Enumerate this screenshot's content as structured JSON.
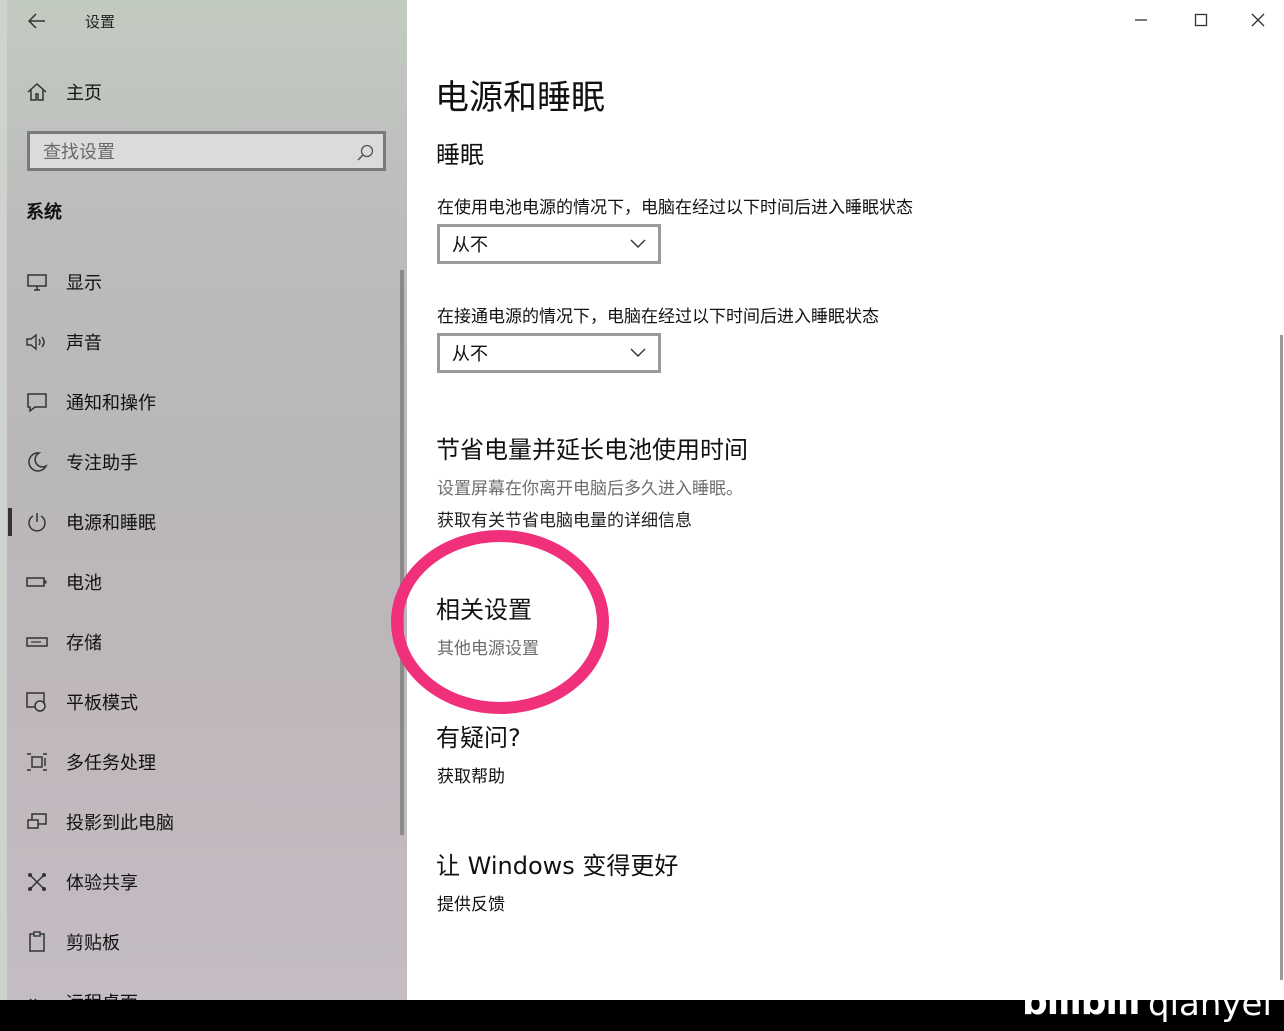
{
  "window": {
    "title": "设置",
    "controls": {
      "minimize": "—",
      "maximize": "☐",
      "close": "✕"
    }
  },
  "sidebar": {
    "home_label": "主页",
    "search_placeholder": "查找设置",
    "section_title": "系统",
    "items": [
      {
        "label": "显示",
        "icon": "display-icon"
      },
      {
        "label": "声音",
        "icon": "speaker-icon"
      },
      {
        "label": "通知和操作",
        "icon": "notification-icon"
      },
      {
        "label": "专注助手",
        "icon": "moon-icon"
      },
      {
        "label": "电源和睡眠",
        "icon": "power-icon",
        "selected": true
      },
      {
        "label": "电池",
        "icon": "battery-icon"
      },
      {
        "label": "存储",
        "icon": "storage-icon"
      },
      {
        "label": "平板模式",
        "icon": "tablet-mode-icon"
      },
      {
        "label": "多任务处理",
        "icon": "multitask-icon"
      },
      {
        "label": "投影到此电脑",
        "icon": "project-icon"
      },
      {
        "label": "体验共享",
        "icon": "share-icon"
      },
      {
        "label": "剪贴板",
        "icon": "clipboard-icon"
      },
      {
        "label": "远程桌面",
        "icon": "remote-desktop-icon"
      }
    ]
  },
  "main": {
    "title": "电源和睡眠",
    "sleep": {
      "heading": "睡眠",
      "battery_label": "在使用电池电源的情况下，电脑在经过以下时间后进入睡眠状态",
      "battery_value": "从不",
      "plugged_label": "在接通电源的情况下，电脑在经过以下时间后进入睡眠状态",
      "plugged_value": "从不"
    },
    "save_power": {
      "heading": "节省电量并延长电池使用时间",
      "desc": "设置屏幕在你离开电脑后多久进入睡眠。",
      "link": "获取有关节省电脑电量的详细信息"
    },
    "related": {
      "heading": "相关设置",
      "link": "其他电源设置"
    },
    "questions": {
      "heading": "有疑问?",
      "link": "获取帮助"
    },
    "improve": {
      "heading": "让 Windows 变得更好",
      "link": "提供反馈"
    }
  },
  "watermark": {
    "text": "qianyei"
  },
  "colors": {
    "highlight_circle": "#f0307a",
    "selected_bar": "#333333"
  }
}
